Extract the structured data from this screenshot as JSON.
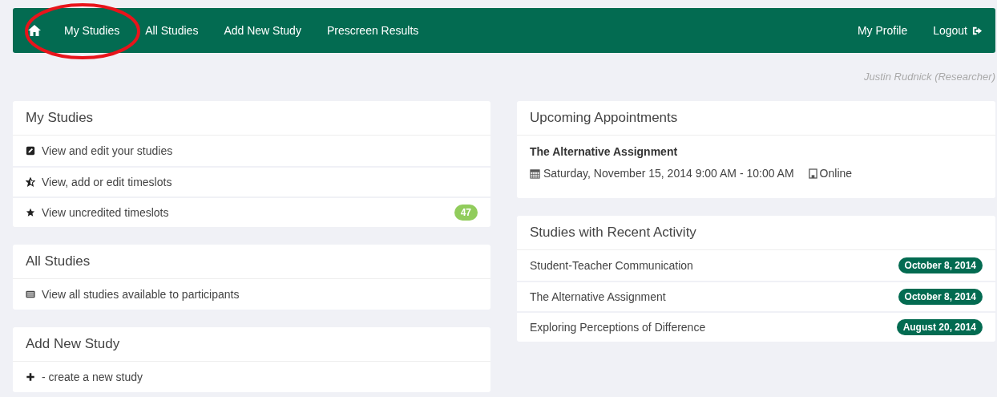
{
  "navbar": {
    "left_items": [
      {
        "label": "My Studies"
      },
      {
        "label": "All Studies"
      },
      {
        "label": "Add New Study"
      },
      {
        "label": "Prescreen Results"
      }
    ],
    "right_items": [
      {
        "label": "My Profile"
      },
      {
        "label": "Logout",
        "kind": "logout"
      }
    ]
  },
  "user": "Justin Rudnick (Researcher)",
  "left_panels": [
    {
      "title": "My Studies",
      "items": [
        {
          "kind": "edit",
          "label": "View and edit your studies"
        },
        {
          "kind": "star-half",
          "label": "View, add or edit timeslots"
        },
        {
          "kind": "star",
          "label": "View uncredited timeslots",
          "badge": "47"
        }
      ]
    },
    {
      "title": "All Studies",
      "items": [
        {
          "kind": "list",
          "label": "View all studies available to participants"
        }
      ]
    },
    {
      "title": "Add New Study",
      "items": [
        {
          "kind": "plus",
          "label": "- create a new study"
        }
      ]
    }
  ],
  "appointments": {
    "title": "Upcoming Appointments",
    "items": [
      {
        "study": "The Alternative Assignment",
        "time": "Saturday, November 15, 2014 9:00 AM - 10:00 AM",
        "location": "Online"
      }
    ]
  },
  "recent": {
    "title": "Studies with Recent Activity",
    "items": [
      {
        "study": "Student-Teacher Communication",
        "date": "October 8, 2014"
      },
      {
        "study": "The Alternative Assignment",
        "date": "October 8, 2014"
      },
      {
        "study": "Exploring Perceptions of Difference",
        "date": "August 20, 2014"
      }
    ]
  }
}
